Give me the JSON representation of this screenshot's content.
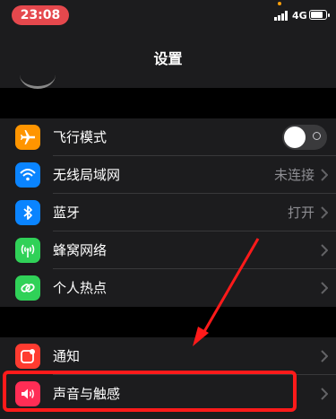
{
  "status_bar": {
    "time": "23:08",
    "network": "4G",
    "time_pill_color": "#e5484d"
  },
  "nav": {
    "title": "设置"
  },
  "group1": [
    {
      "label": "飞行模式",
      "icon": "airplane-icon",
      "icon_color": "#ff9500",
      "control": "toggle",
      "toggle_on": false
    },
    {
      "label": "无线局域网",
      "icon": "wifi-icon",
      "icon_color": "#0a84ff",
      "value": "未连接"
    },
    {
      "label": "蓝牙",
      "icon": "bluetooth-icon",
      "icon_color": "#0a84ff",
      "value": "打开"
    },
    {
      "label": "蜂窝网络",
      "icon": "cellular-antenna-icon",
      "icon_color": "#30d158"
    },
    {
      "label": "个人热点",
      "icon": "hotspot-link-icon",
      "icon_color": "#30d158"
    }
  ],
  "group2": [
    {
      "label": "通知",
      "icon": "notification-icon",
      "icon_color": "#ff3b30"
    },
    {
      "label": "声音与触感",
      "icon": "speaker-icon",
      "icon_color": "#ff2d55"
    }
  ],
  "annotation": {
    "color": "#ff1a1a"
  }
}
